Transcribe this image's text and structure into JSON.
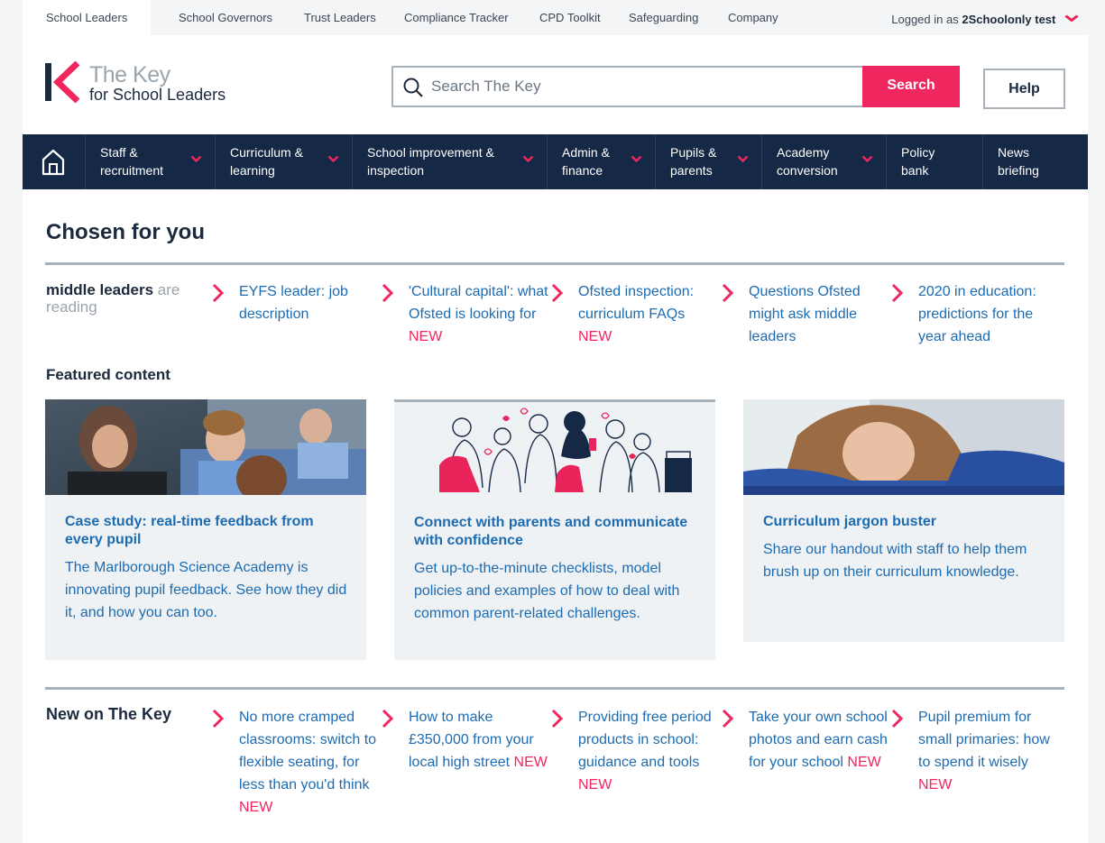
{
  "topbar": {
    "tabs": [
      {
        "label": "School Leaders"
      },
      {
        "label": "School Governors"
      },
      {
        "label": "Trust Leaders"
      },
      {
        "label": "Compliance Tracker"
      },
      {
        "label": "CPD Toolkit"
      },
      {
        "label": "Safeguarding"
      },
      {
        "label": "Company"
      }
    ],
    "login_prefix": "Logged in as",
    "login_user": "2Schoolonly test",
    "login_icon": "chevron-down-icon"
  },
  "logo": {
    "line1": "The Key",
    "line2": "for School Leaders"
  },
  "search": {
    "placeholder": "Search The Key",
    "button": "Search",
    "icon": "search-icon"
  },
  "help": "Help",
  "nav": {
    "home_icon": "home-icon",
    "items": [
      {
        "line1": "Staff &",
        "line2": "recruitment"
      },
      {
        "line1": "Curriculum &",
        "line2": "learning"
      },
      {
        "line1": "School improvement &",
        "line2": "inspection"
      },
      {
        "line1": "Admin &",
        "line2": "finance"
      },
      {
        "line1": "Pupils &",
        "line2": "parents"
      },
      {
        "line1": "Academy",
        "line2": "conversion"
      },
      {
        "line1": "Policy",
        "line2": "bank"
      },
      {
        "line1": "News",
        "line2": "briefing"
      }
    ]
  },
  "chosen": {
    "heading": "Chosen for you",
    "audience": "middle leaders",
    "audience_suffix": "are reading",
    "links": [
      {
        "text": "EYFS leader: job description",
        "new": ""
      },
      {
        "text": "'Cultural capital': what Ofsted is looking for",
        "new": "NEW"
      },
      {
        "text": "Ofsted inspection: curriculum FAQs",
        "new": "NEW"
      },
      {
        "text": "Questions Ofsted might ask middle leaders",
        "new": ""
      },
      {
        "text": "2020 in education: predictions for the year ahead",
        "new": ""
      }
    ]
  },
  "featured": {
    "heading": "Featured content",
    "cards": [
      {
        "title": "Case study: real-time feedback from every pupil",
        "desc": "The Marlborough Science Academy is innovating pupil feedback. See how they did it, and how you can too."
      },
      {
        "title": "Connect with parents and communicate with confidence",
        "desc": "Get up-to-the-minute checklists, model policies and examples of how to deal with common parent-related challenges."
      },
      {
        "title": "Curriculum jargon buster",
        "desc": "Share our handout with staff to help them brush up on their curriculum knowledge."
      }
    ]
  },
  "new_on": {
    "heading": "New on The Key",
    "links": [
      {
        "text": "No more cramped classrooms: switch to flexible seating, for less than you'd think",
        "new": "NEW"
      },
      {
        "text": "How to make £350,000 from your local high street",
        "new": "NEW"
      },
      {
        "text": "Providing free period products in school: guidance and tools",
        "new": "NEW"
      },
      {
        "text": "Take your own school photos and earn cash for your school",
        "new": "NEW"
      },
      {
        "text": "Pupil premium for small primaries: how to spend it wisely",
        "new": "NEW"
      }
    ]
  },
  "colors": {
    "accent": "#f0265e",
    "navy": "#152845",
    "link": "#1d6bb0"
  }
}
